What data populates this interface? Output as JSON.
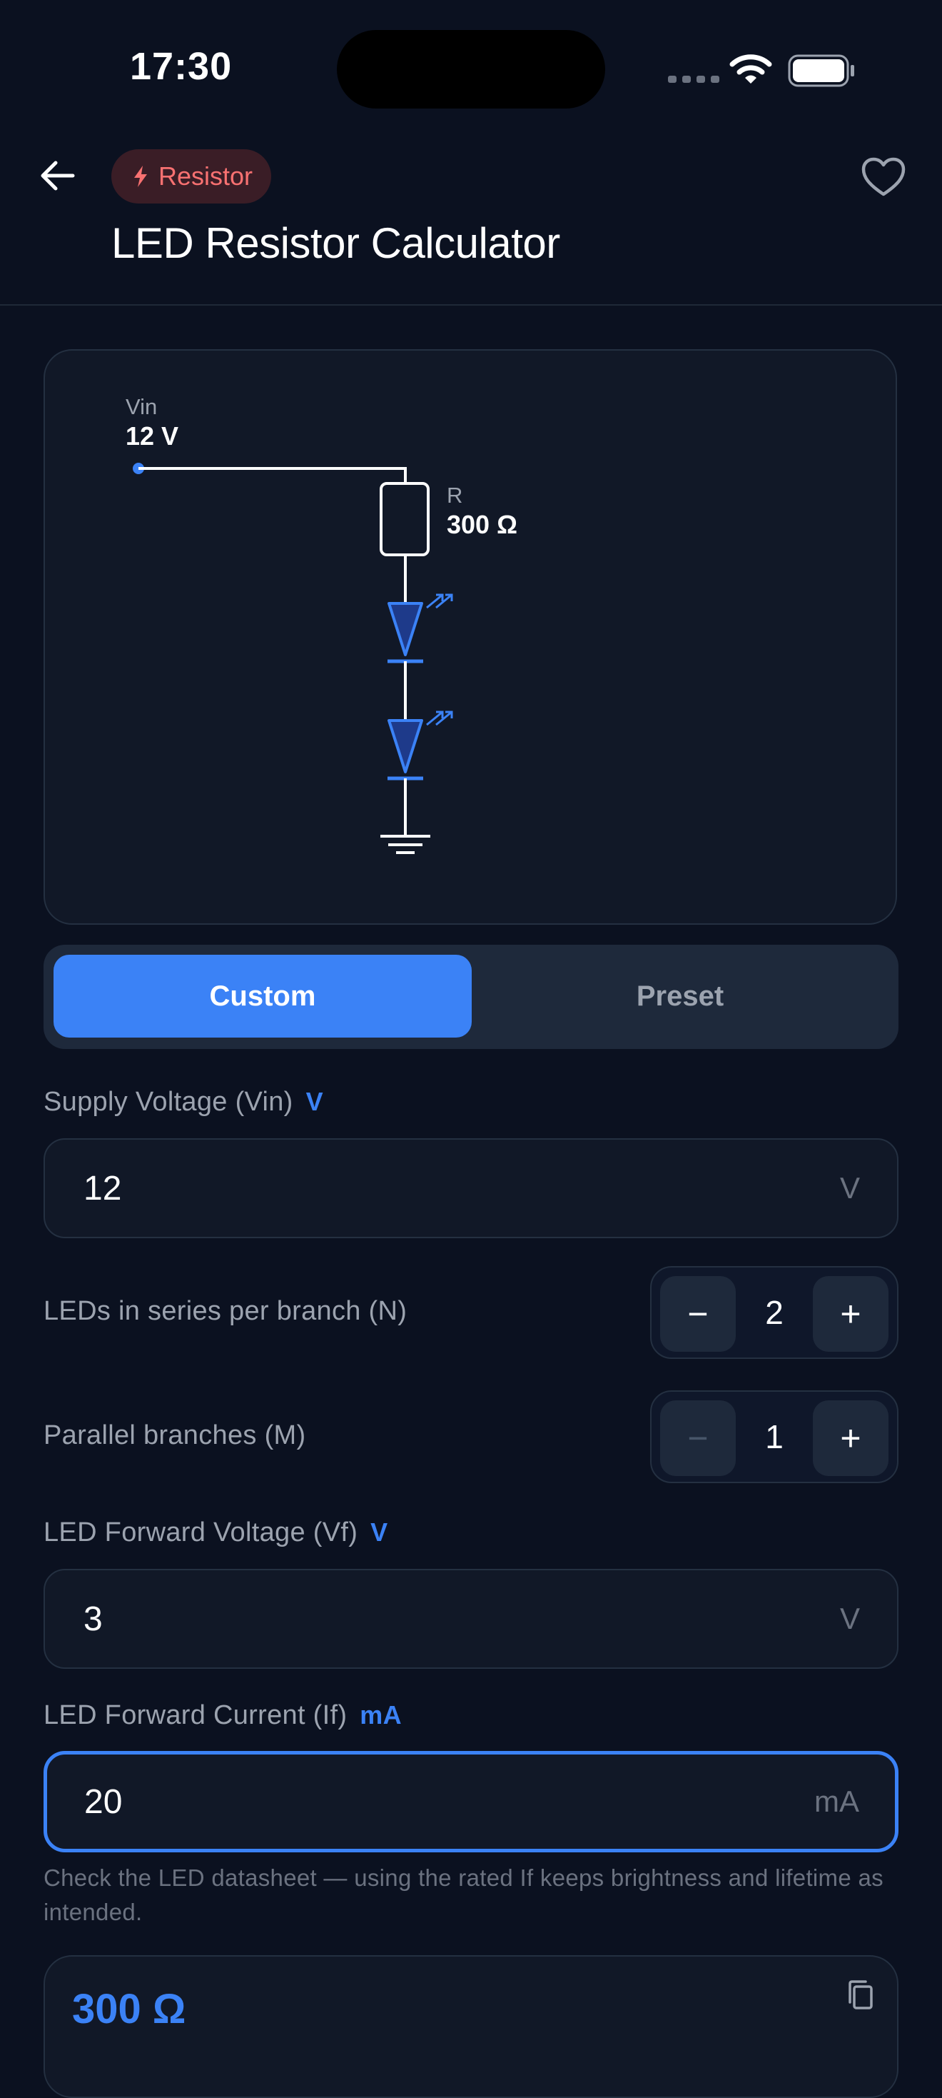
{
  "status_bar": {
    "time": "17:30"
  },
  "header": {
    "chip_label": "Resistor",
    "title": "LED Resistor Calculator"
  },
  "circuit": {
    "vin_label": "Vin",
    "vin_value": "12 V",
    "r_label": "R",
    "r_value": "300 Ω",
    "leds_in_series": 2
  },
  "mode": {
    "options": [
      "Custom",
      "Preset"
    ],
    "selected": "Custom"
  },
  "form": {
    "supply_voltage": {
      "label": "Supply Voltage (Vin)",
      "unit_tag": "V",
      "value": "12",
      "unit": "V"
    },
    "leds_series": {
      "label": "LEDs in series per branch (N)",
      "value": "2",
      "minus": "−",
      "plus": "+"
    },
    "parallel": {
      "label": "Parallel branches (M)",
      "value": "1",
      "minus": "−",
      "plus": "+"
    },
    "forward_voltage": {
      "label": "LED Forward Voltage (Vf)",
      "unit_tag": "V",
      "value": "3",
      "unit": "V"
    },
    "forward_current": {
      "label": "LED Forward Current (If)",
      "unit_tag": "mA",
      "value": "20",
      "unit": "mA"
    },
    "hint": "Check the LED datasheet — using the rated If keeps brightness and lifetime as intended."
  },
  "result": {
    "value": "300 Ω"
  },
  "colors": {
    "accent": "#3b82f6",
    "chip_text": "#f87171",
    "background": "#0b1120"
  }
}
